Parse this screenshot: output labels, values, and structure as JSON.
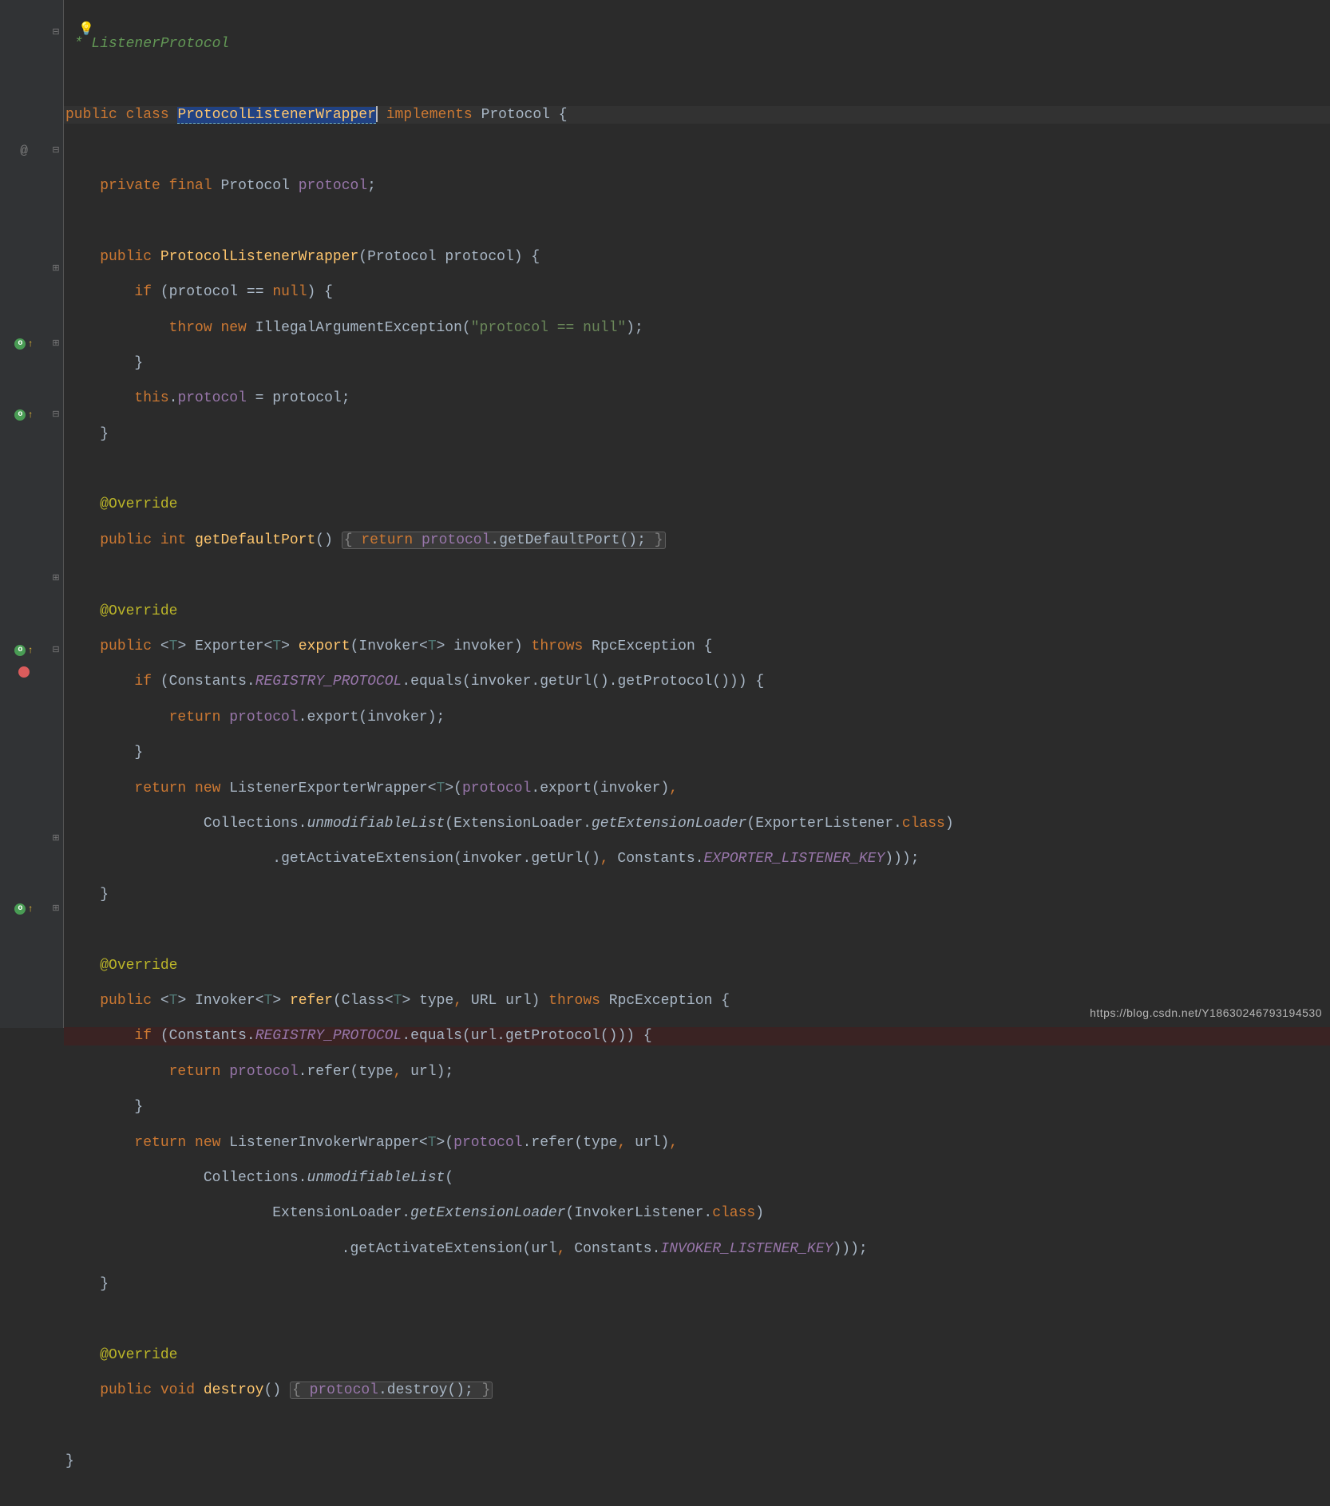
{
  "code": {
    "comment_listener": " * ListenerProtocol",
    "public": "public",
    "class": "class",
    "className": "ProtocolListenerWrapper",
    "implements": "implements",
    "ifaceProtocol": "Protocol",
    "lbrace": "{",
    "rbrace": "}",
    "private": "private",
    "final": "final",
    "field_protocol": "protocol",
    "semicolon": ";",
    "ctor_name": "ProtocolListenerWrapper",
    "paren_open": "(",
    "paren_close": ")",
    "if": "if",
    "null": "null",
    "eqeq": "==",
    "throw": "throw",
    "new": "new",
    "IAE": "IllegalArgumentException",
    "str_protocol_null": "\"protocol == null\"",
    "this": "this",
    "dot": ".",
    "equals_op": " = ",
    "override": "@Override",
    "int": "int",
    "getDefaultPort": "getDefaultPort",
    "return": "return",
    "fold_open": "{",
    "fold_close": "}",
    "folded_body_gdp": " return protocol.getDefaultPort(); ",
    "Exporter": "Exporter",
    "T": "T",
    "lt": "<",
    "gt": ">",
    "export": "export",
    "Invoker": "Invoker",
    "invoker_param": "invoker",
    "throws": "throws",
    "RpcException": "RpcException",
    "Constants": "Constants",
    "REGISTRY_PROTOCOL": "REGISTRY_PROTOCOL",
    "equals": "equals",
    "getUrl": "getUrl",
    "getProtocol": "getProtocol",
    "ListenerExporterWrapper": "ListenerExporterWrapper",
    "Collections": "Collections",
    "unmodifiableList": "unmodifiableList",
    "ExtensionLoader": "ExtensionLoader",
    "getExtensionLoader": "getExtensionLoader",
    "ExporterListener": "ExporterListener",
    "class_kw": "class",
    "getActivateExtension": "getActivateExtension",
    "EXPORTER_LISTENER_KEY": "EXPORTER_LISTENER_KEY",
    "refer": "refer",
    "Class": "Class",
    "type_param": "type",
    "URL": "URL",
    "url_param": "url",
    "ListenerInvokerWrapper": "ListenerInvokerWrapper",
    "InvokerListener": "InvokerListener",
    "INVOKER_LISTENER_KEY": "INVOKER_LISTENER_KEY",
    "void": "void",
    "destroy": "destroy",
    "folded_body_destroy": " protocol.destroy(); ",
    "comma": ","
  },
  "watermark": "https://blog.csdn.net/Y18630246793194530"
}
